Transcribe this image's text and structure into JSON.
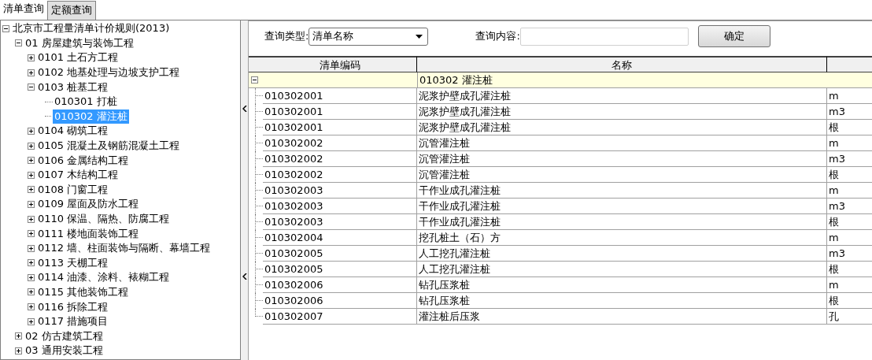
{
  "tabs": [
    {
      "label": "清单查询",
      "selected": true
    },
    {
      "label": "定额查询",
      "selected": false
    }
  ],
  "tree": [
    {
      "label": "北京市工程量清单计价规则(2013)",
      "expanded": true,
      "selected": false,
      "children": [
        {
          "label": "01  房屋建筑与装饰工程",
          "expanded": true,
          "selected": false,
          "children": [
            {
              "label": "0101  土石方工程",
              "expanded": false,
              "selected": false
            },
            {
              "label": "0102  地基处理与边坡支护工程",
              "expanded": false,
              "selected": false
            },
            {
              "label": "0103  桩基工程",
              "expanded": true,
              "selected": false,
              "children": [
                {
                  "label": "010301  打桩",
                  "selected": false
                },
                {
                  "label": "010302  灌注桩",
                  "selected": true
                }
              ]
            },
            {
              "label": "0104  砌筑工程",
              "expanded": false,
              "selected": false
            },
            {
              "label": "0105  混凝土及钢筋混凝土工程",
              "expanded": false,
              "selected": false
            },
            {
              "label": "0106  金属结构工程",
              "expanded": false,
              "selected": false
            },
            {
              "label": "0107  木结构工程",
              "expanded": false,
              "selected": false
            },
            {
              "label": "0108  门窗工程",
              "expanded": false,
              "selected": false
            },
            {
              "label": "0109  屋面及防水工程",
              "expanded": false,
              "selected": false
            },
            {
              "label": "0110  保温、隔热、防腐工程",
              "expanded": false,
              "selected": false
            },
            {
              "label": "0111  楼地面装饰工程",
              "expanded": false,
              "selected": false
            },
            {
              "label": "0112  墙、柱面装饰与隔断、幕墙工程",
              "expanded": false,
              "selected": false
            },
            {
              "label": "0113  天棚工程",
              "expanded": false,
              "selected": false
            },
            {
              "label": "0114  油漆、涂料、裱糊工程",
              "expanded": false,
              "selected": false
            },
            {
              "label": "0115  其他装饰工程",
              "expanded": false,
              "selected": false
            },
            {
              "label": "0116  拆除工程",
              "expanded": false,
              "selected": false
            },
            {
              "label": "0117  措施项目",
              "expanded": false,
              "selected": false
            }
          ]
        },
        {
          "label": "02  仿古建筑工程",
          "expanded": false,
          "selected": false
        },
        {
          "label": "03  通用安装工程",
          "expanded": false,
          "selected": false
        }
      ]
    }
  ],
  "query": {
    "type_label": "查询类型:",
    "type_value": "清单名称",
    "content_label": "查询内容:",
    "confirm_button": "确定"
  },
  "table": {
    "columns": [
      "清单编码",
      "名称"
    ],
    "group": {
      "label": "010302  灌注桩",
      "expanded": true
    },
    "rows": [
      {
        "code": "010302001",
        "name": "泥浆护壁成孔灌注桩",
        "unit": "m"
      },
      {
        "code": "010302001",
        "name": "泥浆护壁成孔灌注桩",
        "unit": "m3"
      },
      {
        "code": "010302001",
        "name": "泥浆护壁成孔灌注桩",
        "unit": "根"
      },
      {
        "code": "010302002",
        "name": "沉管灌注桩",
        "unit": "m"
      },
      {
        "code": "010302002",
        "name": "沉管灌注桩",
        "unit": "m3"
      },
      {
        "code": "010302002",
        "name": "沉管灌注桩",
        "unit": "根"
      },
      {
        "code": "010302003",
        "name": "干作业成孔灌注桩",
        "unit": "m"
      },
      {
        "code": "010302003",
        "name": "干作业成孔灌注桩",
        "unit": "m3"
      },
      {
        "code": "010302003",
        "name": "干作业成孔灌注桩",
        "unit": "根"
      },
      {
        "code": "010302004",
        "name": "挖孔桩土（石）方",
        "unit": "m"
      },
      {
        "code": "010302005",
        "name": "人工挖孔灌注桩",
        "unit": "m3"
      },
      {
        "code": "010302005",
        "name": "人工挖孔灌注桩",
        "unit": "根"
      },
      {
        "code": "010302006",
        "name": "钻孔压浆桩",
        "unit": "m"
      },
      {
        "code": "010302006",
        "name": "钻孔压浆桩",
        "unit": "根"
      },
      {
        "code": "010302007",
        "name": "灌注桩后压浆",
        "unit": "孔"
      }
    ]
  }
}
